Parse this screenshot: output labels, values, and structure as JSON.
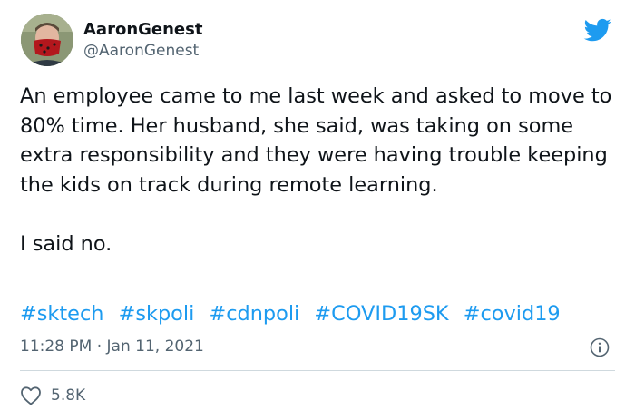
{
  "author": {
    "display_name": "AaronGenest",
    "handle": "@AaronGenest"
  },
  "tweet": {
    "paragraphs": [
      "An employee came to me last week and asked to move to 80% time. Her husband, she said, was taking on some extra responsibility and they were having trouble keeping the kids on track during remote learning.",
      "I said no."
    ],
    "hashtags": [
      "#sktech",
      "#skpoli",
      "#cdnpoli",
      "#COVID19SK",
      "#covid19"
    ],
    "timestamp": "11:28 PM · Jan 11, 2021"
  },
  "actions": {
    "like_count": "5.8K"
  },
  "icons": {
    "brand": "twitter-bird-icon",
    "info": "info-icon",
    "like": "heart-icon"
  },
  "colors": {
    "brand_blue": "#1d9bf0",
    "text_primary": "#0f1419",
    "text_secondary": "#536471",
    "divider": "#cfd9de"
  }
}
